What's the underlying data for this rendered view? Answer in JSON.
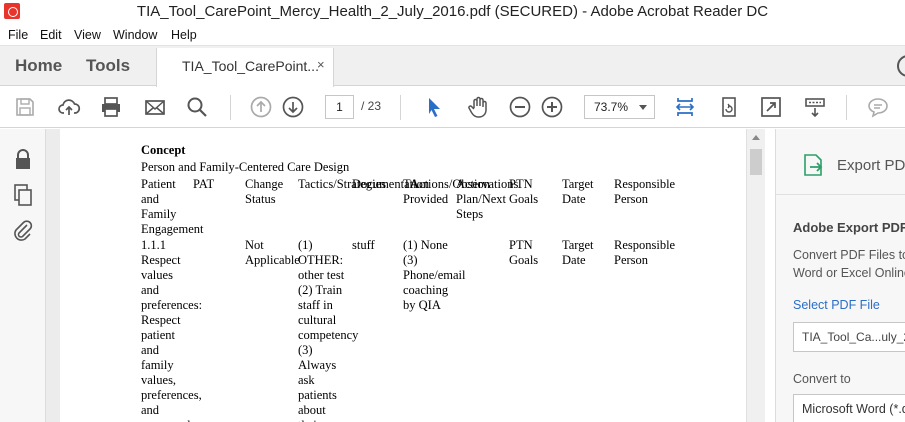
{
  "window": {
    "title": "TIA_Tool_CarePoint_Mercy_Health_2_July_2016.pdf (SECURED) - Adobe Acrobat Reader DC"
  },
  "menu": [
    "File",
    "Edit",
    "View",
    "Window",
    "Help"
  ],
  "tabs": {
    "home": "Home",
    "tools": "Tools",
    "document": "TIA_Tool_CarePoint...",
    "close": "×"
  },
  "toolbar": {
    "page_current": "1",
    "page_total": "/ 23",
    "zoom": "73.7%"
  },
  "document": {
    "heading": "Concept",
    "subheading": "Person and Family-Centered Care Design",
    "columns": {
      "c1": [
        "Patient",
        "and",
        "Family",
        "Engagement"
      ],
      "c2": [
        "PAT"
      ],
      "c3": [
        "Change",
        "Status"
      ],
      "c4": [
        "Tactics/Strategies"
      ],
      "c5": [
        "Documentation"
      ],
      "c6": [
        "TA",
        "Provided"
      ],
      "c7": [
        "Actions/Observations"
      ],
      "c7b": [
        "Action",
        "Plan/Next",
        "Steps"
      ],
      "c8": [
        "PTN",
        "Goals"
      ],
      "c9": [
        "Target",
        "Date"
      ],
      "c10": [
        "Responsible",
        "Person"
      ]
    },
    "row": {
      "c1": [
        "1.1.1",
        "Respect",
        "values",
        "and",
        "preferences:",
        "Respect",
        "patient",
        "and",
        "family",
        "values,",
        "preferences,",
        "and",
        "expressed"
      ],
      "c3": [
        "Not",
        "Applicable"
      ],
      "c4": [
        "(1)",
        "OTHER:",
        "other test",
        "(2) Train",
        "staff in",
        "cultural",
        "competency",
        "(3)",
        "Always",
        "ask",
        "patients",
        "about",
        "their"
      ],
      "c5": [
        "stuff"
      ],
      "c6": [
        "(1) None",
        "(3)",
        "Phone/email",
        "coaching",
        "by QIA"
      ],
      "c8": [
        "PTN",
        "Goals"
      ],
      "c9": [
        "Target",
        "Date"
      ],
      "c10": [
        "Responsible",
        "Person"
      ]
    }
  },
  "export_panel": {
    "header": "Export PDF",
    "title": "Adobe Export PDF",
    "description": "Convert PDF Files to Word or Excel Online",
    "select_link": "Select PDF File",
    "file_name": "TIA_Tool_Ca...uly_2016.pdf",
    "convert_label": "Convert to",
    "convert_value": "Microsoft Word (*.docx)"
  },
  "colors": {
    "accent_blue": "#2b6ec6",
    "adobe_red": "#e8342a",
    "export_green": "#2e9e6b"
  }
}
